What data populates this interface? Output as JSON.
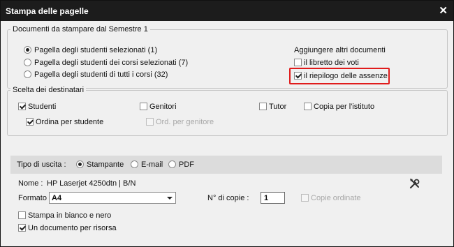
{
  "window": {
    "title": "Stampa delle pagelle",
    "close_glyph": "✕"
  },
  "documents": {
    "legend": "Documenti da stampare dal Semestre 1",
    "options": [
      {
        "label": "Pagella degli studenti selezionati (1)",
        "selected": true
      },
      {
        "label": "Pagella degli studenti dei corsi selezionati (7)",
        "selected": false
      },
      {
        "label": "Pagella degli studenti di tutti i corsi (32)",
        "selected": false
      }
    ],
    "extra_title": "Aggiungere altri documenti",
    "extras": [
      {
        "label": "il libretto dei voti",
        "checked": false
      },
      {
        "label": "il riepilogo delle assenze",
        "checked": true
      }
    ],
    "highlight_color": "#e01b1b"
  },
  "recipients": {
    "legend": "Scelta dei destinatari",
    "students": {
      "label": "Studenti",
      "checked": true
    },
    "parents": {
      "label": "Genitori",
      "checked": false
    },
    "tutor": {
      "label": "Tutor",
      "checked": false
    },
    "institute_copy": {
      "label": "Copia per l'istituto",
      "checked": false
    },
    "order_by_student": {
      "label": "Ordina per studente",
      "checked": true
    },
    "order_by_parent": {
      "label": "Ord. per genitore",
      "checked": false,
      "disabled": true
    }
  },
  "output": {
    "label": "Tipo di uscita :",
    "options": [
      {
        "label": "Stampante",
        "selected": true
      },
      {
        "label": "E-mail",
        "selected": false
      },
      {
        "label": "PDF",
        "selected": false
      }
    ]
  },
  "printer": {
    "name_label": "Nome :",
    "name_value": "HP Laserjet 4250dtn | B/N",
    "settings_icon": "tools-icon",
    "format_label": "Formato",
    "format_value": "A4",
    "copies_label": "N° di copie :",
    "copies_value": "1",
    "collated": {
      "label": "Copie ordinate",
      "checked": false,
      "disabled": true
    },
    "black_white": {
      "label": "Stampa in bianco e nero",
      "checked": false
    },
    "one_doc_per_resource": {
      "label": "Un documento per risorsa",
      "checked": true
    }
  }
}
